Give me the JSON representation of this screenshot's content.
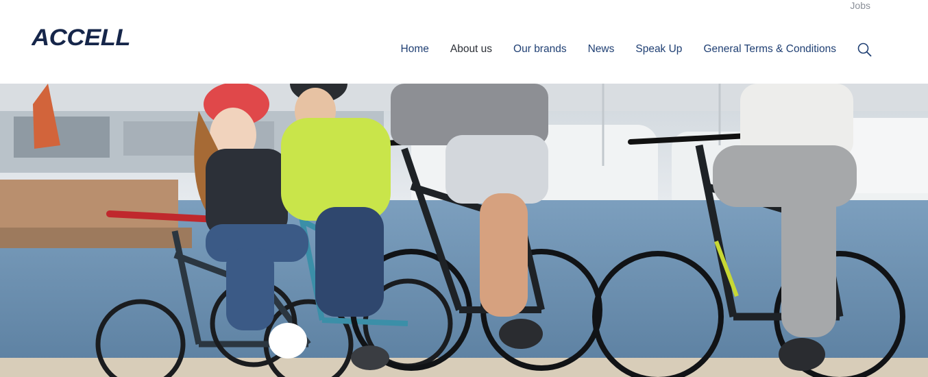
{
  "top_links": {
    "jobs_label": "Jobs"
  },
  "logo": {
    "text": "ACCELL"
  },
  "nav": {
    "items": [
      {
        "label": "Home"
      },
      {
        "label": "About us"
      },
      {
        "label": "Our brands"
      },
      {
        "label": "News"
      },
      {
        "label": "Speak Up"
      },
      {
        "label": "General Terms & Conditions"
      }
    ],
    "active_item": "About us",
    "search_icon": "search-icon"
  },
  "hero": {
    "image_subject": "family-cycling-photo"
  },
  "colors": {
    "brand_navy": "#16264a",
    "nav_link": "#1f3f73",
    "nav_active": "#2b2f36",
    "top_link": "#8a8f98"
  }
}
